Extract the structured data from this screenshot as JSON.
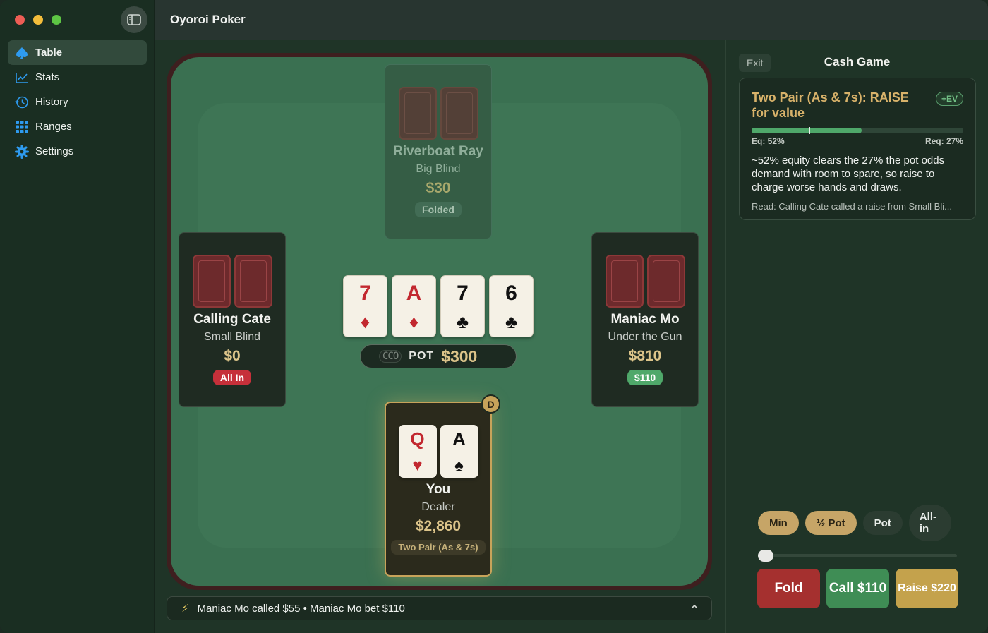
{
  "app": {
    "title": "Oyoroi Poker"
  },
  "sidebar": {
    "items": [
      {
        "label": "Table",
        "icon": "spade-icon",
        "active": true
      },
      {
        "label": "Stats",
        "icon": "chart-icon",
        "active": false
      },
      {
        "label": "History",
        "icon": "clock-icon",
        "active": false
      },
      {
        "label": "Ranges",
        "icon": "grid-icon",
        "active": false
      },
      {
        "label": "Settings",
        "icon": "gear-icon",
        "active": false
      }
    ]
  },
  "table": {
    "players": {
      "top": {
        "name": "Riverboat Ray",
        "role": "Big Blind",
        "stack": "$30",
        "status": "Folded"
      },
      "left": {
        "name": "Calling Cate",
        "role": "Small Blind",
        "stack": "$0",
        "status": "All In"
      },
      "right": {
        "name": "Maniac Mo",
        "role": "Under the Gun",
        "stack": "$810",
        "status": "$110"
      },
      "hero": {
        "name": "You",
        "role": "Dealer",
        "stack": "$2,860",
        "hand_label": "Two Pair (As & 7s)",
        "dealer_button": "D",
        "cards": [
          {
            "rank": "Q",
            "suit": "♥",
            "color": "red"
          },
          {
            "rank": "A",
            "suit": "♠",
            "color": "black"
          }
        ]
      }
    },
    "board": [
      {
        "rank": "7",
        "suit": "♦",
        "color": "red"
      },
      {
        "rank": "A",
        "suit": "♦",
        "color": "red"
      },
      {
        "rank": "7",
        "suit": "♣",
        "color": "black"
      },
      {
        "rank": "6",
        "suit": "♣",
        "color": "black"
      }
    ],
    "pot": {
      "chips": "CCO",
      "label": "POT",
      "amount": "$300"
    },
    "action_log": "Maniac Mo called $55 • Maniac Mo bet $110"
  },
  "panel": {
    "exit_label": "Exit",
    "title": "Cash Game",
    "advice": {
      "headline": "Two Pair (As & 7s): RAISE for value",
      "badge": "+EV",
      "equity_label": "Eq: 52%",
      "required_label": "Req: 27%",
      "equity": 0.52,
      "required": 0.27,
      "body": "~52% equity clears the 27% the pot odds demand with room to spare, so raise to charge worse hands and draws.",
      "read": "Read: Calling Cate called a raise from Small Bli..."
    },
    "sizing": {
      "min": "Min",
      "half": "½ Pot",
      "pot": "Pot",
      "allin": "All-in"
    },
    "slider_value": 0,
    "actions": {
      "fold": "Fold",
      "call": "Call $110",
      "raise": "Raise $220"
    }
  },
  "colors": {
    "felt": "#3a7051",
    "rail": "#3e1f1f",
    "gold": "#c6a567",
    "fold": "#a5302f",
    "call": "#3f8d55"
  }
}
